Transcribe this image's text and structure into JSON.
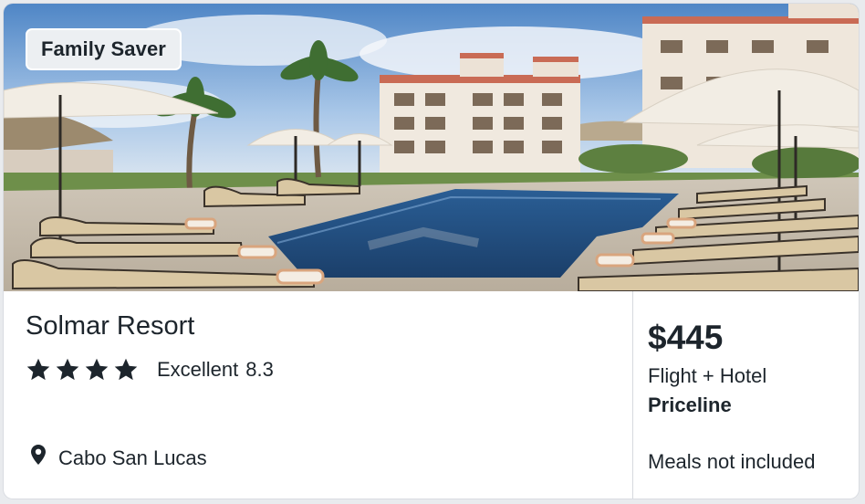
{
  "badge": {
    "label": "Family Saver"
  },
  "hotel": {
    "name": "Solmar Resort",
    "star_rating": 4,
    "rating_word": "Excellent",
    "rating_score": "8.3",
    "location": "Cabo San Lucas"
  },
  "offer": {
    "price": "$445",
    "package": "Flight + Hotel",
    "provider": "Priceline",
    "meals": "Meals not included"
  },
  "icons": {
    "star": "star-icon",
    "location": "map-pin-icon"
  },
  "colors": {
    "text": "#1d252c",
    "badge_bg": "#eceff2",
    "divider": "#d6d9de"
  }
}
